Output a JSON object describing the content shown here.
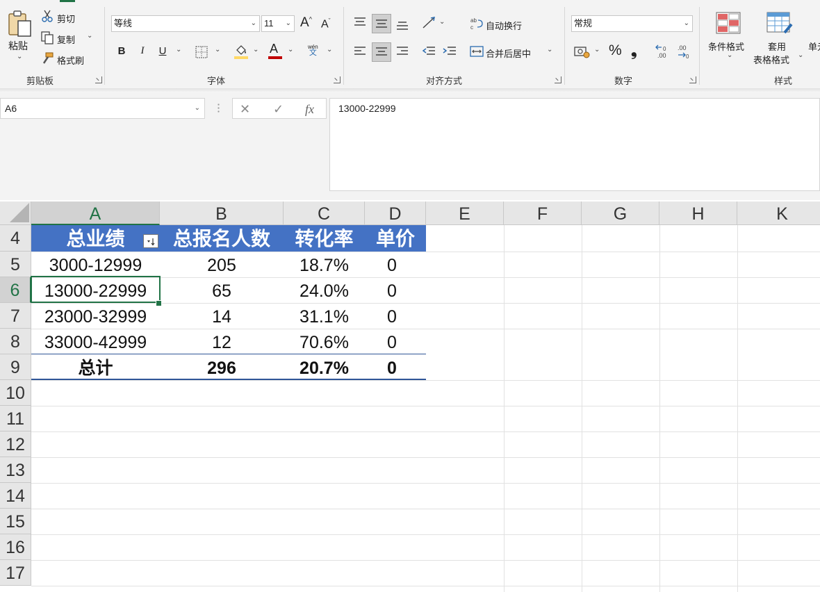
{
  "ribbon": {
    "clipboard": {
      "paste": "粘贴",
      "cut": "剪切",
      "copy": "复制",
      "format_painter": "格式刷",
      "group": "剪贴板"
    },
    "font": {
      "name": "等线",
      "size": "11",
      "grow": "A",
      "shrink": "A",
      "bold": "B",
      "italic": "I",
      "underline": "U",
      "font_color": "A",
      "phonetic_top": "wén",
      "phonetic_bottom": "文",
      "group": "字体"
    },
    "alignment": {
      "wrap": "自动换行",
      "merge": "合并后居中",
      "group": "对齐方式"
    },
    "number": {
      "format": "常规",
      "percent": "%",
      "comma": "❟",
      "group": "数字"
    },
    "styles": {
      "conditional": "条件格式",
      "table_line1": "套用",
      "table_line2": "表格格式",
      "cell_styles": "单元",
      "group": "样式"
    },
    "accent_color": "#217346"
  },
  "formula_bar": {
    "name_box": "A6",
    "cancel": "✕",
    "enter": "✓",
    "fx": "fx",
    "content": "13000-22999"
  },
  "columns": [
    "A",
    "B",
    "C",
    "D",
    "E",
    "F",
    "G",
    "H",
    "K"
  ],
  "rows": [
    "4",
    "5",
    "6",
    "7",
    "8",
    "9",
    "10",
    "11",
    "12",
    "13",
    "14",
    "15",
    "16",
    "17"
  ],
  "table": {
    "header_color": "#4472c4",
    "headers": [
      "总业绩",
      "总报名人数",
      "转化率",
      "单价"
    ],
    "data": [
      [
        "3000-12999",
        "205",
        "18.7%",
        "0"
      ],
      [
        "13000-22999",
        "65",
        "24.0%",
        "0"
      ],
      [
        "23000-32999",
        "14",
        "31.1%",
        "0"
      ],
      [
        "33000-42999",
        "12",
        "70.6%",
        "0"
      ]
    ],
    "total": [
      "总计",
      "296",
      "20.7%",
      "0"
    ]
  }
}
